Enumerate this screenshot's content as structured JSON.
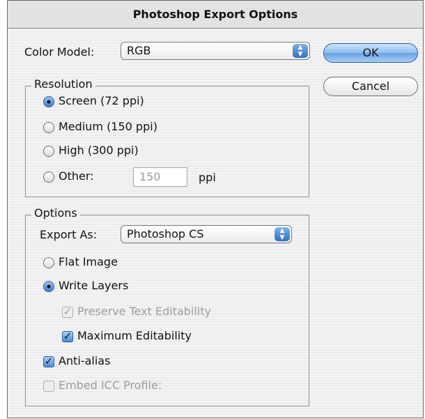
{
  "dialog": {
    "title": "Photoshop Export Options"
  },
  "color_model": {
    "label": "Color Model:",
    "value": "RGB"
  },
  "buttons": {
    "ok": "OK",
    "cancel": "Cancel"
  },
  "resolution": {
    "legend": "Resolution",
    "options": [
      {
        "label": "Screen (72 ppi)",
        "selected": true
      },
      {
        "label": "Medium (150 ppi)",
        "selected": false
      },
      {
        "label": "High (300 ppi)",
        "selected": false
      },
      {
        "label": "Other:",
        "selected": false
      }
    ],
    "other_value": "150",
    "other_unit": "ppi"
  },
  "options": {
    "legend": "Options",
    "export_as_label": "Export As:",
    "export_as_value": "Photoshop CS",
    "flat_image": "Flat Image",
    "write_layers": "Write Layers",
    "preserve_text": "Preserve Text Editability",
    "max_edit": "Maximum Editability",
    "anti_alias": "Anti-alias",
    "embed_icc": "Embed ICC Profile:"
  },
  "colors": {
    "accent": "#3f7fd1",
    "disabled_text": "#9c9c9c"
  }
}
